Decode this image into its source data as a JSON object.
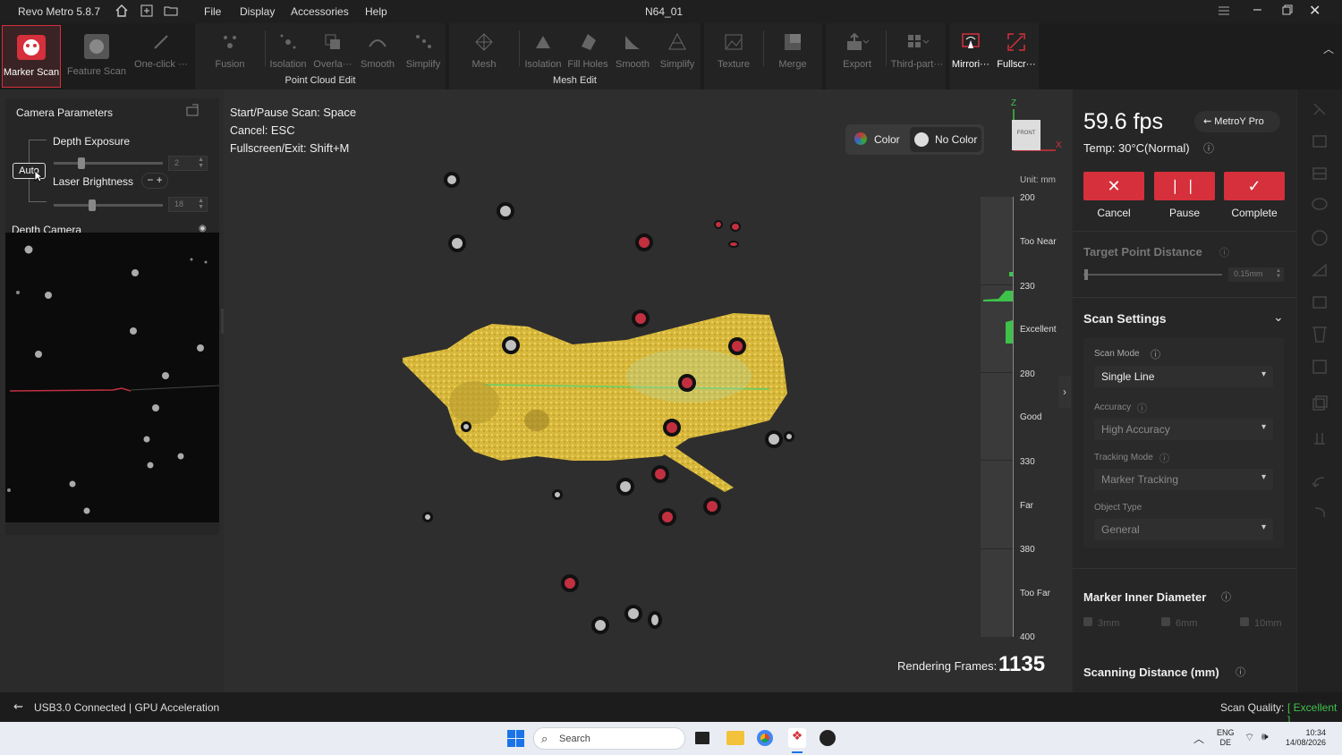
{
  "titlebar": {
    "app": "Revo Metro 5.8.7",
    "menus": [
      "File",
      "Display",
      "Accessories",
      "Help"
    ],
    "doc": "N64_01"
  },
  "ribbon": {
    "marker_scan": "Marker Scan",
    "feature_scan": "Feature Scan",
    "one_click": "One-click ···",
    "pc": {
      "fusion": "Fusion",
      "isolation": "Isolation",
      "overlap": "Overla···",
      "smooth": "Smooth",
      "simplify": "Simplify",
      "label": "Point Cloud Edit"
    },
    "me": {
      "mesh": "Mesh",
      "isolation": "Isolation",
      "fill": "Fill Holes",
      "smooth": "Smooth",
      "simplify": "Simplify",
      "label": "Mesh Edit"
    },
    "texture": "Texture",
    "merge": "Merge",
    "export": "Export",
    "third": "Third-part···",
    "mirror": "Mirrori···",
    "fullscreen": "Fullscr···"
  },
  "left": {
    "title": "Camera Parameters",
    "depth_exposure": "Depth Exposure",
    "auto": "Auto",
    "depth_val": "2",
    "laser": "Laser Brightness",
    "laser_minus": "−",
    "laser_plus": "+",
    "laser_val": "18",
    "depth_cam": "Depth Camera",
    "depth_slider": 0.25,
    "laser_slider": 0.35
  },
  "vp": {
    "hint1k": "Start/Pause Scan:",
    "hint1v": "Space",
    "hint2k": "Cancel:",
    "hint2v": "ESC",
    "hint3k": "Fullscreen/Exit:",
    "hint3v": "Shift+M",
    "color": "Color",
    "nocolor": "No Color",
    "cube": "FRONT",
    "ax_z": "Z",
    "ax_x": "X",
    "unit": "Unit: mm",
    "scale": [
      "200",
      "230",
      "280",
      "330",
      "380",
      "400"
    ],
    "zones": [
      "Too Near",
      "Excellent",
      "Good",
      "Far",
      "Too Far"
    ],
    "frames_label": "Rendering Frames:",
    "frames": "1135"
  },
  "right": {
    "fps": "59.6 fps",
    "device": "MetroY Pro",
    "temp": "Temp:  30°C(Normal)",
    "cancel": "Cancel",
    "pause": "Pause",
    "complete": "Complete",
    "tpd": "Target Point Distance",
    "tpd_val": "0.15mm",
    "tpd_slider": 0.02,
    "scan_settings": "Scan Settings",
    "scan_mode_l": "Scan Mode",
    "scan_mode": "Single Line",
    "accuracy_l": "Accuracy",
    "accuracy": "High Accuracy",
    "tracking_l": "Tracking Mode",
    "tracking": "Marker Tracking",
    "object_l": "Object Type",
    "object": "General",
    "mid": "Marker Inner Diameter",
    "d1": "3mm",
    "d2": "6mm",
    "d3": "10mm",
    "sd": "Scanning Distance (mm)"
  },
  "status": {
    "usb": "USB3.0 Connected",
    "gpu": "| GPU Acceleration",
    "sq": "Scan Quality:",
    "sqv": "[ Excellent ]"
  },
  "taskbar": {
    "search": "Search",
    "lang1": "ENG",
    "lang2": "DE",
    "time": "10:34",
    "date": "14/08/2026"
  },
  "colors": {
    "accent": "#d5303b",
    "excellent": "#3fc24a",
    "cloud": "#e8c84a"
  }
}
